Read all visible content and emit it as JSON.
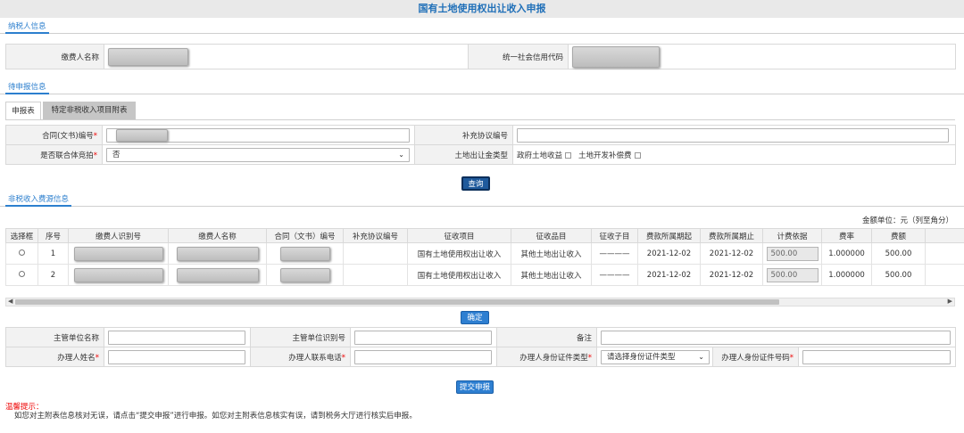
{
  "page_title": "国有土地使用权出让收入申报",
  "sections": {
    "taxpayer": "纳税人信息",
    "pending": "待申报信息",
    "source": "非税收入费源信息"
  },
  "taxpayer": {
    "name_label": "缴费人名称",
    "credit_code_label": "统一社会信用代码"
  },
  "tabs": [
    {
      "label": "申报表"
    },
    {
      "label": "特定非税收入项目附表"
    }
  ],
  "form": {
    "contract_label": "合同(文书)编号",
    "supplement_label": "补充协议编号",
    "joint_bid_label": "是否联合体竞拍",
    "joint_bid_value": "否",
    "fee_type_label": "土地出让金类型",
    "fee_type_options": [
      "政府土地收益",
      "土地开发补偿费"
    ]
  },
  "query_button": "查询",
  "unit_note": "金额单位：元（列至角分）",
  "grid": {
    "headers": [
      "选择框",
      "序号",
      "缴费人识别号",
      "缴费人名称",
      "合同（文书）编号",
      "补充协议编号",
      "征收项目",
      "征收品目",
      "征收子目",
      "费款所属期起",
      "费款所属期止",
      "计费依据",
      "费率",
      "费额"
    ],
    "rows": [
      {
        "seq": "1",
        "item": "国有土地使用权出让收入",
        "category": "其他土地出让收入",
        "sub": "————",
        "start": "2021-12-02",
        "end": "2021-12-02",
        "basis": "500.00",
        "rate": "1.000000",
        "amount": "500.00"
      },
      {
        "seq": "2",
        "item": "国有土地使用权出让收入",
        "category": "其他土地出让收入",
        "sub": "————",
        "start": "2021-12-02",
        "end": "2021-12-02",
        "basis": "500.00",
        "rate": "1.000000",
        "amount": "500.00"
      }
    ]
  },
  "confirm_button": "确定",
  "bottom_form": {
    "dept_name_label": "主管单位名称",
    "dept_id_label": "主管单位识别号",
    "remark_label": "备注",
    "handler_name_label": "办理人姓名",
    "handler_phone_label": "办理人联系电话",
    "id_type_label": "办理人身份证件类型",
    "id_type_placeholder": "请选择身份证件类型",
    "id_number_label": "办理人身份证件号码"
  },
  "submit_button": "提交申报",
  "tips": {
    "title": "温馨提示：",
    "body": "如您对主附表信息核对无误，请点击“提交申报”进行申报。如您对主附表信息核实有误，请到税务大厅进行核实后申报。"
  },
  "colors": {
    "accent": "#2c7fce",
    "title_text": "#1f6fb8",
    "required": "#e00000"
  }
}
